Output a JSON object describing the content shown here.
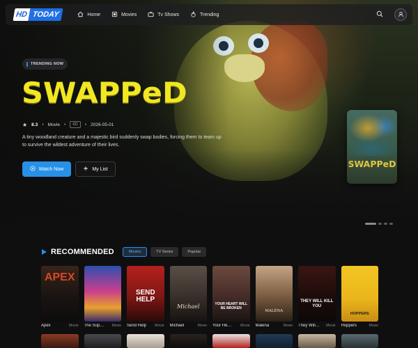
{
  "logo": {
    "part1": "HD",
    "part2": "TODAY"
  },
  "nav": {
    "items": [
      {
        "label": "Home",
        "icon": "home-icon"
      },
      {
        "label": "Movies",
        "icon": "film-icon"
      },
      {
        "label": "Tv Shows",
        "icon": "tv-icon"
      },
      {
        "label": "Trending",
        "icon": "flame-icon"
      }
    ]
  },
  "hero": {
    "badge": "TRENDING NOW",
    "title": "SWAPPeD",
    "rating": "8.3",
    "type": "Movie",
    "cc": "CC",
    "date": "2026-05-01",
    "synopsis": "A tiny woodland creature and a majestic bird suddenly swap bodies, forcing them to team up to survive the wildest adventure of their lives.",
    "watch_label": "Watch Now",
    "list_label": "My List",
    "poster_title": "SWAPPeD"
  },
  "colors": {
    "accent": "#2791e7",
    "title_yellow": "#f1e722"
  },
  "recommended": {
    "title": "RECOMMENDED",
    "filters": [
      "Movies",
      "TV Series",
      "Popular"
    ],
    "active_filter": "Movies",
    "items": [
      {
        "name": "Apex",
        "kind": "Movie",
        "poster_text": "APEX"
      },
      {
        "name": "The Sup…",
        "kind": "Movie",
        "poster_text": ""
      },
      {
        "name": "Send Help",
        "kind": "Movie",
        "poster_text": "SEND HELP"
      },
      {
        "name": "Michael",
        "kind": "Movie",
        "poster_text": "Michael"
      },
      {
        "name": "Your He…",
        "kind": "Movie",
        "poster_text": "YOUR HEART WILL BE BROKEN"
      },
      {
        "name": "Malena",
        "kind": "Movie",
        "poster_text": "MALÈNA"
      },
      {
        "name": "They Will…",
        "kind": "Movie",
        "poster_text": "THEY WILL KILL YOU"
      },
      {
        "name": "Hoppers",
        "kind": "Movie",
        "poster_text": "HOPPERS"
      }
    ]
  }
}
